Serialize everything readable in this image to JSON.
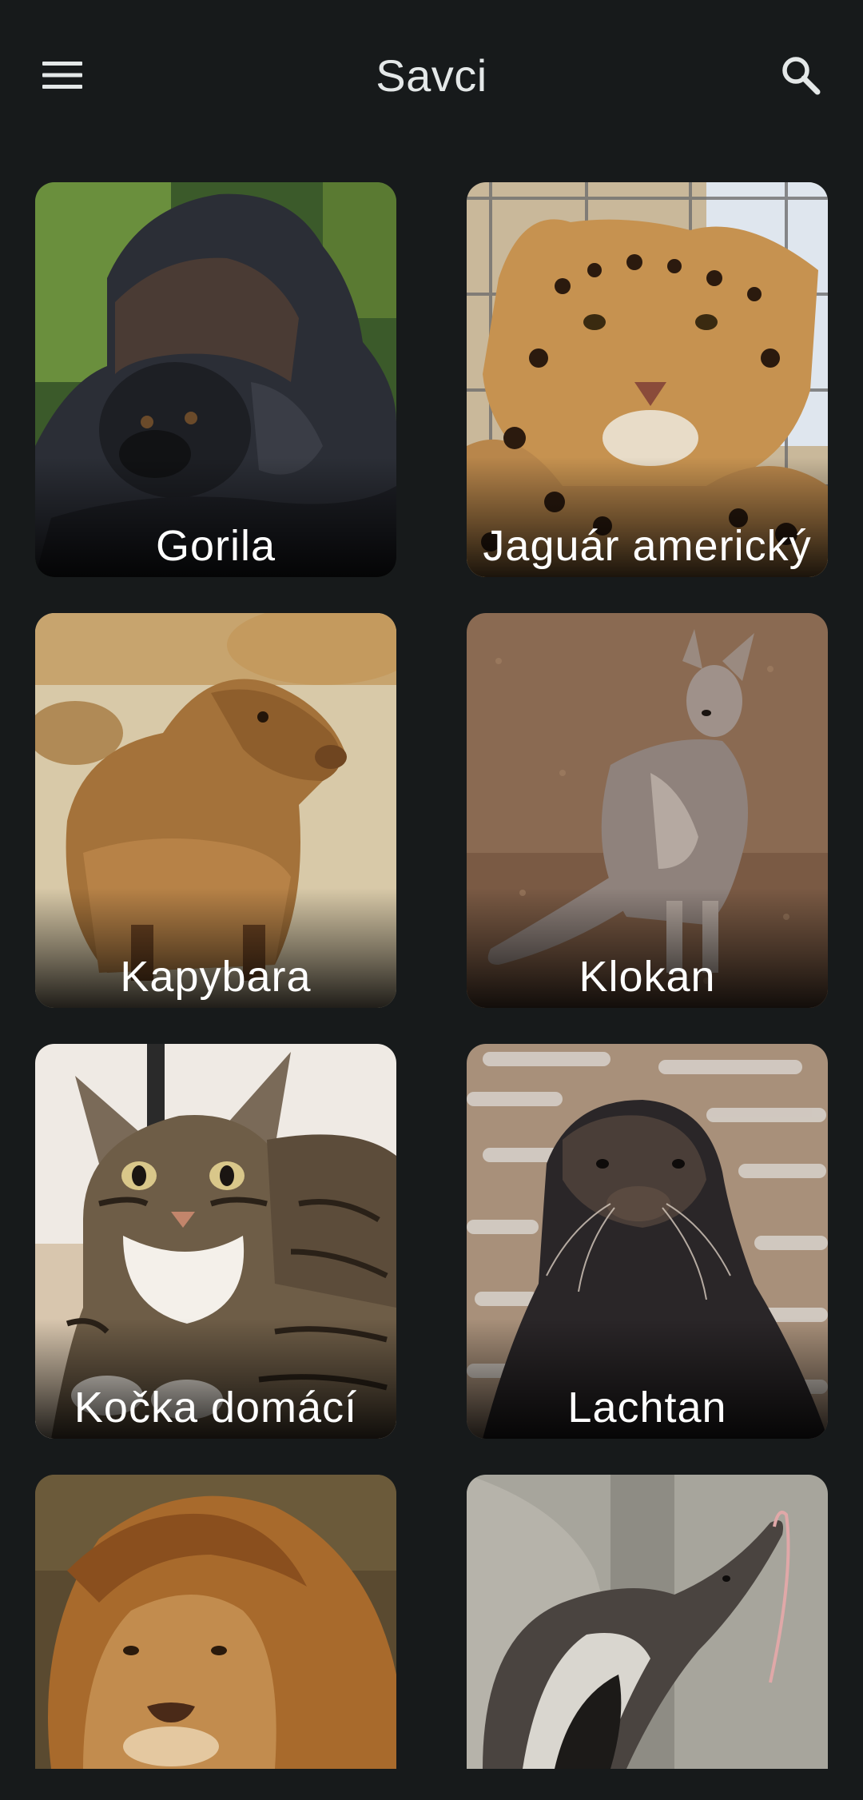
{
  "header": {
    "title": "Savci",
    "menu_icon": "menu-icon",
    "search_icon": "search-icon"
  },
  "colors": {
    "background": "#171a1b",
    "text": "#e9eeee"
  },
  "animals": [
    {
      "id": "gorila",
      "label": "Gorila"
    },
    {
      "id": "jaguar",
      "label": "Jaguár americký"
    },
    {
      "id": "kapybara",
      "label": "Kapybara"
    },
    {
      "id": "klokan",
      "label": "Klokan"
    },
    {
      "id": "kocka",
      "label": "Kočka domácí"
    },
    {
      "id": "lachtan",
      "label": "Lachtan"
    },
    {
      "id": "lev",
      "label": ""
    },
    {
      "id": "mravenecnik",
      "label": ""
    }
  ]
}
